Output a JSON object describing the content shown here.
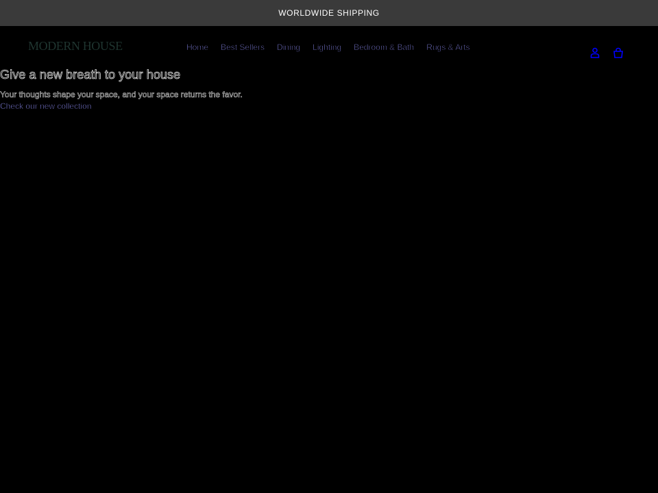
{
  "announcement": {
    "text": "WORLDWIDE SHIPPING"
  },
  "header": {
    "logo": "MODERN HOUSE",
    "nav": [
      {
        "label": "Home"
      },
      {
        "label": "Best Sellers"
      },
      {
        "label": "Dining"
      },
      {
        "label": "Lighting"
      },
      {
        "label": "Bedroom & Bath"
      },
      {
        "label": "Rugs & Arts"
      }
    ],
    "icons": {
      "account": "account-icon",
      "cart": "cart-icon"
    }
  },
  "hero": {
    "title": "Give a new breath to your house",
    "subtitle": "Your thoughts shape your space, and your space returns the favor.",
    "link": "Check our new collection"
  },
  "colors": {
    "background": "#000000",
    "announcement_bg": "#3a3a3a",
    "link": "#8e8cf5",
    "logo": "#1f3530",
    "icon": "#0000ff"
  }
}
